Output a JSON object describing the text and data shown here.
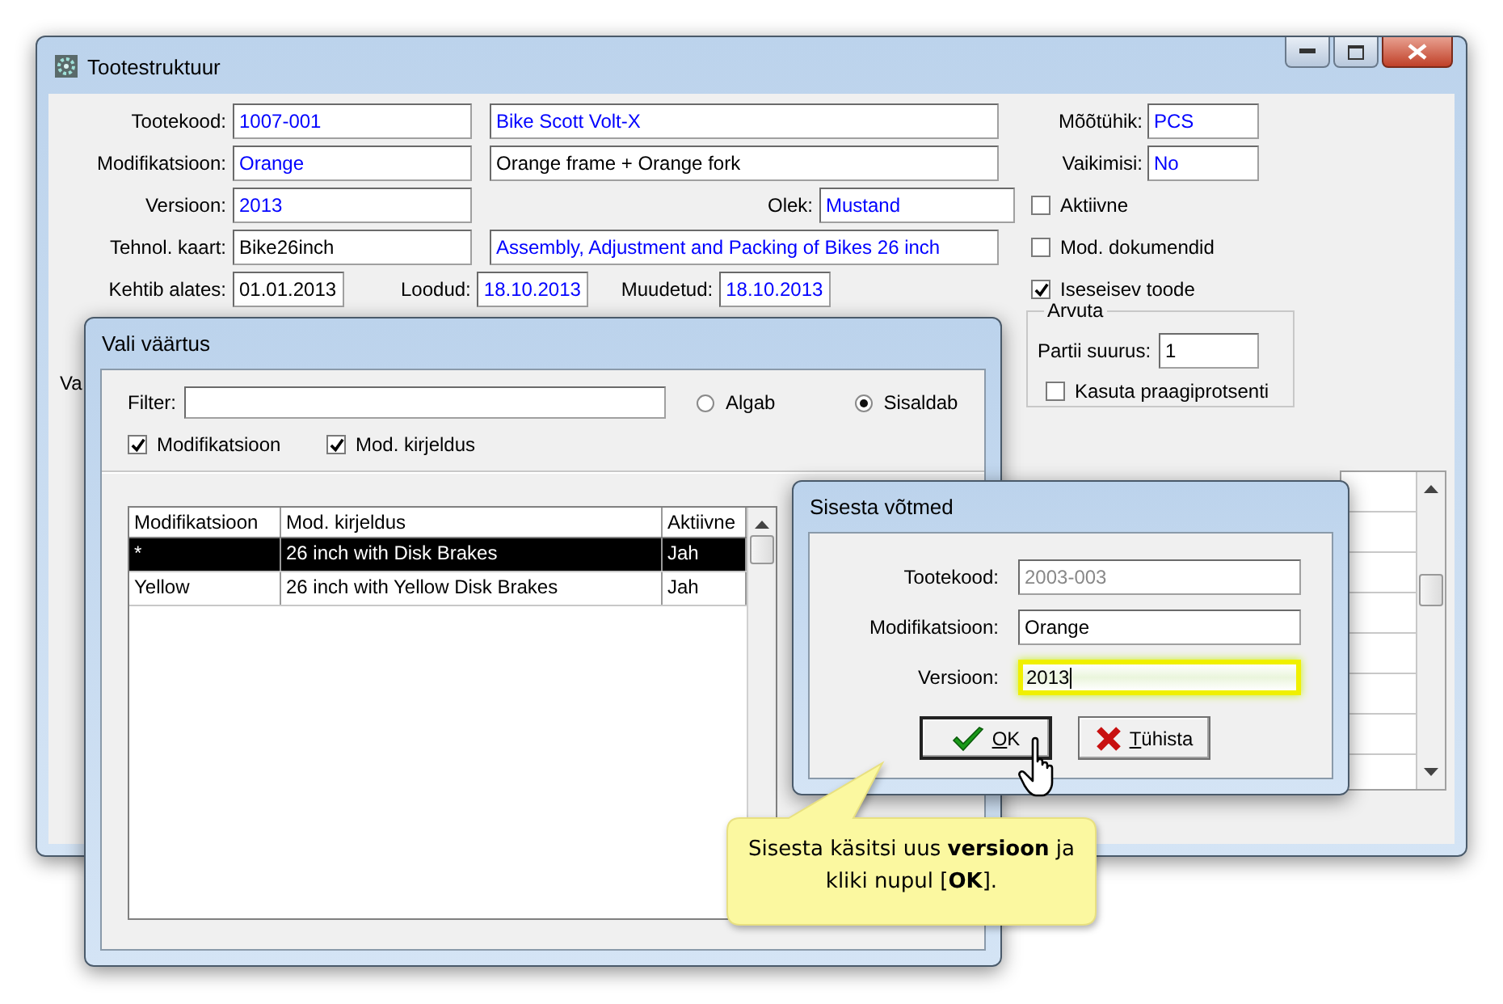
{
  "main_window": {
    "title": "Tootestruktuur",
    "rows": [
      {
        "label": "Tootekood:",
        "value": "1007-001",
        "color": "#0000ff",
        "desc": {
          "text": "Bike Scott Volt-X",
          "color": "#0000ff"
        }
      },
      {
        "label": "Modifikatsioon:",
        "value": "Orange",
        "color": "#0000ff",
        "desc": {
          "text": "Orange frame + Orange fork",
          "color": "#000000"
        }
      },
      {
        "label": "Versioon:",
        "value": "2013",
        "color": "#0000ff",
        "side": {
          "label": "Olek:",
          "value": "Mustand",
          "color": "#0000ff"
        }
      },
      {
        "label": "Tehnol. kaart:",
        "value": "Bike26inch",
        "color": "#000000",
        "desc": {
          "text": "Assembly, Adjustment and Packing of Bikes 26 inch",
          "color": "#0000ff"
        }
      }
    ],
    "dates": [
      {
        "label": "Kehtib alates:",
        "value": "01.01.2013",
        "color": "#000000"
      },
      {
        "label": "Loodud:",
        "value": "18.10.2013",
        "color": "#0000ff"
      },
      {
        "label": "Muudetud:",
        "value": "18.10.2013",
        "color": "#0000ff"
      }
    ],
    "unit_fields": [
      {
        "label": "Mõõtühik:",
        "value": "PCS"
      },
      {
        "label": "Vaikimisi:",
        "value": "No"
      }
    ],
    "options": [
      {
        "label": "Aktiivne",
        "checked": false
      },
      {
        "label": "Mod. dokumendid",
        "checked": false
      },
      {
        "label": "Iseseisev toode",
        "checked": true
      }
    ],
    "arvuta": {
      "title": "Arvuta",
      "batch_label": "Partii suurus:",
      "batch_value": "1",
      "scrap": {
        "label": "Kasuta praagiprotsenti",
        "checked": false
      }
    },
    "partial_label": "Va"
  },
  "select_dialog": {
    "title": "Vali väärtus",
    "filter_label": "Filter:",
    "match": [
      {
        "label": "Algab",
        "selected": false
      },
      {
        "label": "Sisaldab",
        "selected": true
      }
    ],
    "search_in": [
      {
        "label": "Modifikatsioon",
        "checked": true
      },
      {
        "label": "Mod. kirjeldus",
        "checked": true
      }
    ],
    "table": {
      "columns": [
        "Modifikatsioon",
        "Mod. kirjeldus",
        "Aktiivne"
      ],
      "rows": [
        {
          "cells": [
            "*",
            "26 inch with Disk Brakes",
            "Jah"
          ],
          "selected": true
        },
        {
          "cells": [
            "Yellow",
            "26 inch with Yellow Disk Brakes",
            "Jah"
          ],
          "selected": false
        }
      ]
    }
  },
  "keys_dialog": {
    "title": "Sisesta võtmed",
    "fields": [
      {
        "label": "Tootekood:",
        "value": "2003-003",
        "disabled": true,
        "focused": false
      },
      {
        "label": "Modifikatsioon:",
        "value": "Orange",
        "disabled": false,
        "focused": false
      },
      {
        "label": "Versioon:",
        "value": "2013",
        "disabled": false,
        "focused": true
      }
    ],
    "buttons": [
      {
        "label": "OK",
        "kind": "ok"
      },
      {
        "label": "Tühista",
        "kind": "cancel"
      }
    ]
  },
  "callout": {
    "text": "Sisesta käsitsi uus **versioon** ja kliki nupul [**OK**]."
  }
}
